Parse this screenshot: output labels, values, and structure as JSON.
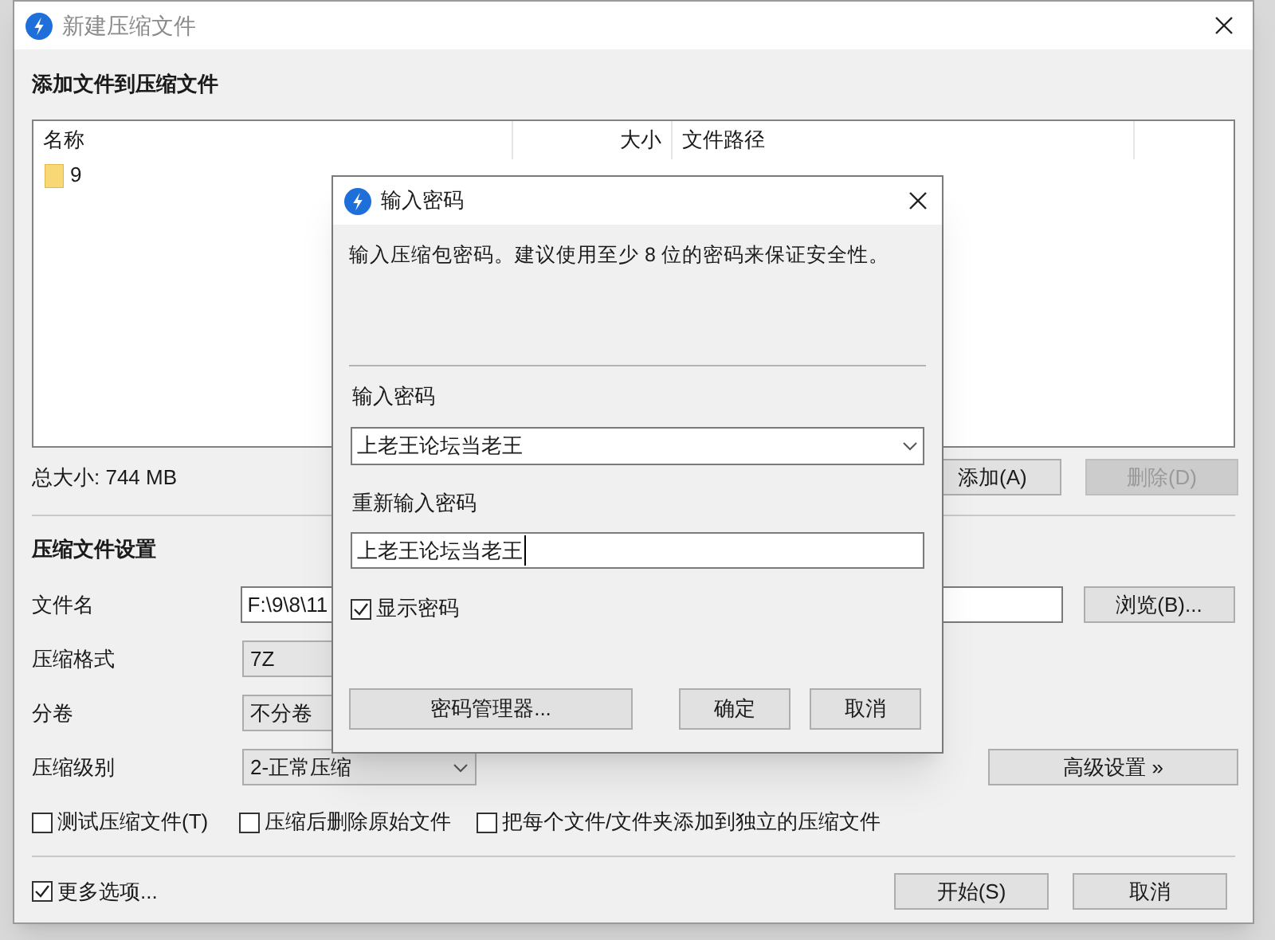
{
  "main_window": {
    "title": "新建压缩文件",
    "section_title": "添加文件到压缩文件",
    "file_list": {
      "columns": [
        "名称",
        "大小",
        "文件路径"
      ],
      "rows": [
        {
          "name": "9"
        }
      ]
    },
    "total_size": "总大小: 744 MB",
    "list_buttons": [
      {
        "label": "添加(A)",
        "disabled": false
      },
      {
        "label": "删除(D)",
        "disabled": true
      }
    ],
    "settings_title": "压缩文件设置",
    "fields": [
      {
        "kind": "text",
        "label": "文件名",
        "value": "F:\\9\\8\\11"
      },
      {
        "kind": "covered_select",
        "label": "压缩格式",
        "value": "7Z"
      },
      {
        "kind": "covered_select",
        "label": "分卷",
        "value": "不分卷"
      },
      {
        "kind": "select",
        "label": "压缩级别",
        "value": "2-正常压缩"
      }
    ],
    "browse_button": "浏览(B)...",
    "advanced_button": "高级设置 »",
    "options": [
      {
        "label": "测试压缩文件(T)",
        "checked": false
      },
      {
        "label": "压缩后删除原始文件",
        "checked": false
      },
      {
        "label": "把每个文件/文件夹添加到独立的压缩文件",
        "checked": false
      }
    ],
    "more_options": {
      "label": "更多选项...",
      "checked": true
    },
    "buttons": [
      "开始(S)",
      "取消"
    ]
  },
  "password_dialog": {
    "title": "输入密码",
    "message": "输入压缩包密码。建议使用至少 8 位的密码来保证安全性。",
    "password_label": "输入密码",
    "password": "上老王论坛当老王",
    "confirm_label": "重新输入密码",
    "confirm_password": "上老王论坛当老王",
    "show_password": {
      "label": "显示密码",
      "checked": true
    },
    "manager_button": "密码管理器...",
    "buttons": [
      "确定",
      "取消"
    ]
  }
}
